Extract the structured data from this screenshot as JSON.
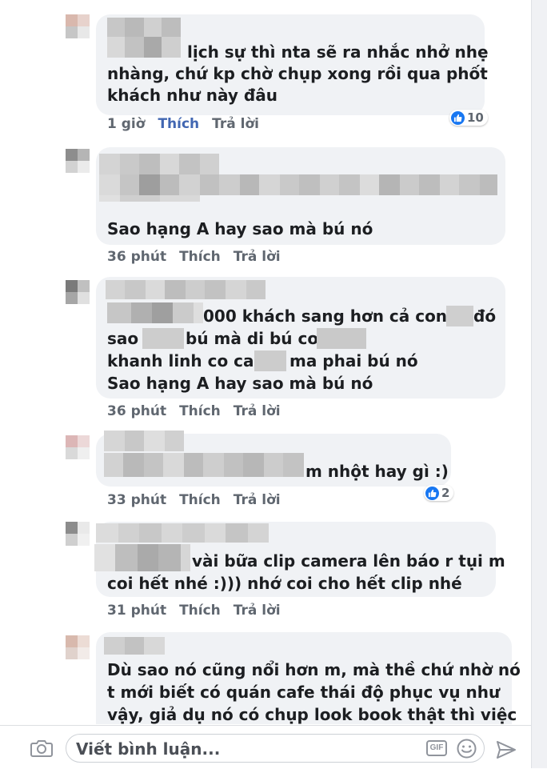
{
  "comments": [
    {
      "lines": [
        "lịch sự thì nta sẽ ra nhắc nhở nhẹ",
        "nhàng, chứ kp chờ chụp xong rồi qua phốt",
        "khách như này đâu"
      ],
      "time": "1 giờ",
      "like_label": "Thích",
      "like_active": true,
      "reply_label": "Trả lời",
      "reaction_count": "10"
    },
    {
      "lines": [
        "Sao hạng A hay sao mà bú nó"
      ],
      "time": "36 phút",
      "like_label": "Thích",
      "reply_label": "Trả lời"
    },
    {
      "lines": [
        "000 khách sang hơn cả con",
        "đó",
        "sao",
        "bú mà di bú con",
        "khanh linh co cai",
        "ma phai bú nó",
        "Sao hạng A hay sao mà bú nó"
      ],
      "time": "36 phút",
      "like_label": "Thích",
      "reply_label": "Trả lời"
    },
    {
      "lines": [
        "m nhột hay gì :)"
      ],
      "time": "33 phút",
      "like_label": "Thích",
      "reply_label": "Trả lời",
      "reaction_count": "2"
    },
    {
      "lines": [
        "vài bữa clip camera lên báo r tụi m",
        "coi hết nhé :))) nhớ coi cho hết clip nhé"
      ],
      "time": "31 phút",
      "like_label": "Thích",
      "reply_label": "Trả lời"
    },
    {
      "lines": [
        "Dù sao nó cũng nổi hơn m, mà thề chứ nhờ nó",
        "t mới biết có quán cafe thái độ phục vụ như",
        "vậy, giả dụ nó có chụp look book thật thì việc"
      ]
    }
  ],
  "composer": {
    "placeholder": "Viết bình luận...",
    "gif_label": "GIF",
    "icons": [
      "camera-icon",
      "gif-icon",
      "emoji-icon",
      "send-icon"
    ]
  },
  "colors": {
    "bubble": "#f0f2f5",
    "like_active": "#4267b2",
    "reaction_blue": "#1877f2",
    "action_gray": "#606770"
  }
}
